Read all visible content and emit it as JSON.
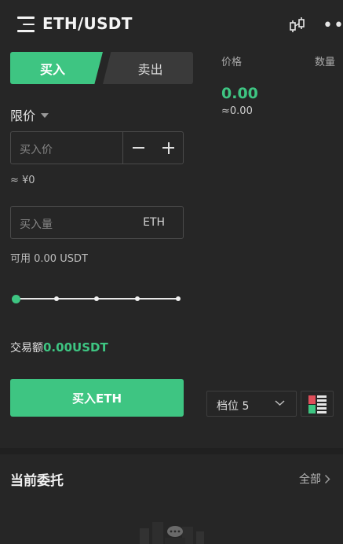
{
  "header": {
    "pair": "ETH/USDT",
    "more": "•••"
  },
  "trade_tabs": {
    "buy": "买入",
    "sell": "卖出"
  },
  "order_book": {
    "price_header": "价格",
    "qty_header": "数量",
    "last_price": "0.00",
    "last_price_approx": "≈0.00"
  },
  "order_form": {
    "order_type": "限价",
    "price_placeholder": "买入价",
    "price_hint": "≈ ¥0",
    "amount_placeholder": "买入量",
    "amount_unit": "ETH",
    "available": "可用 0.00 USDT",
    "slider_percent": 0,
    "trade_amount_label": "交易额",
    "trade_amount_value": "0.00USDT",
    "submit_label": "买入ETH"
  },
  "depth": {
    "label": "档位 5"
  },
  "orders": {
    "title": "当前委托",
    "all_label": "全部"
  },
  "colors": {
    "accent_green": "#3ec582",
    "sell_red": "#e04e5a",
    "background": "#262626"
  }
}
